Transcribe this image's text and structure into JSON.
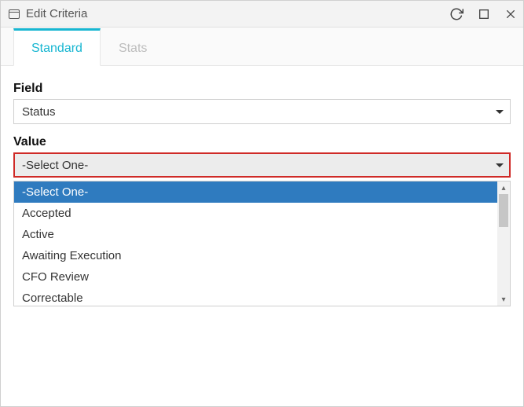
{
  "window": {
    "title": "Edit Criteria"
  },
  "tabs": [
    {
      "label": "Standard",
      "active": true
    },
    {
      "label": "Stats",
      "active": false
    }
  ],
  "field": {
    "label": "Field",
    "selected": "Status"
  },
  "value": {
    "label": "Value",
    "selected": "-Select One-",
    "options": [
      "-Select One-",
      "Accepted",
      "Active",
      "Awaiting Execution",
      "CFO Review",
      "Correctable"
    ],
    "highlighted_index": 0
  }
}
